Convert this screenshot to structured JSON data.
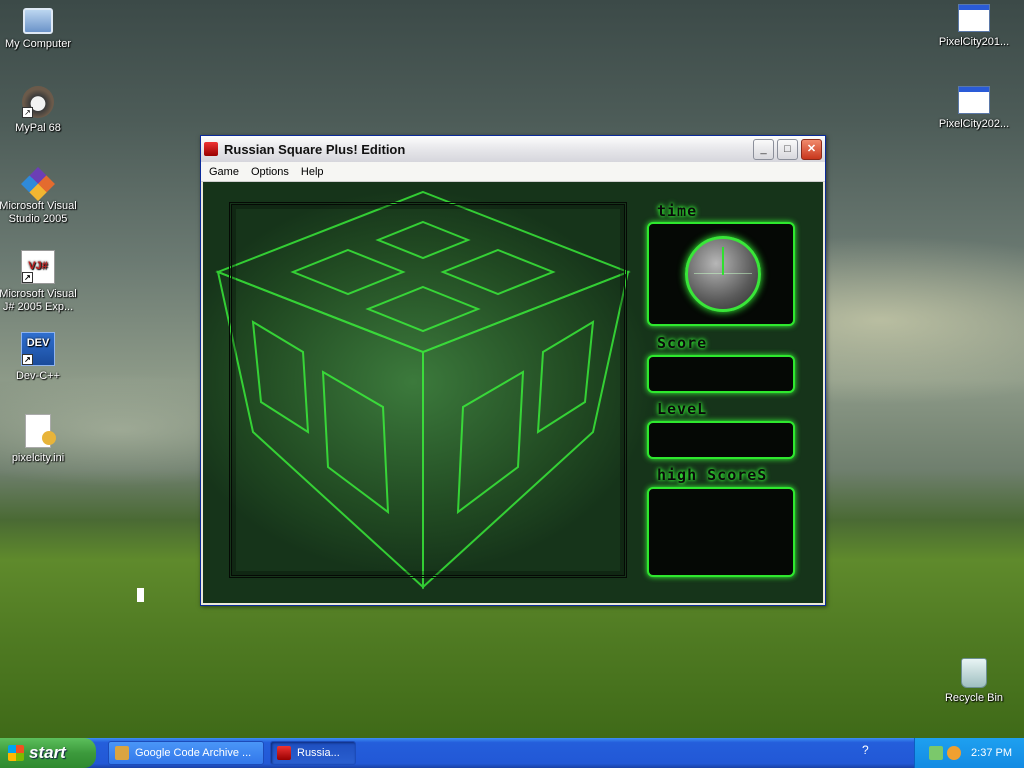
{
  "desktop": {
    "icons_left": [
      {
        "label": "My Computer",
        "icon": "computer-icon"
      },
      {
        "label": "MyPal 68",
        "icon": "raccoon-icon",
        "shortcut": true
      },
      {
        "label": "Microsoft Visual Studio 2005",
        "icon": "visual-studio-icon",
        "shortcut": true
      },
      {
        "label": "Microsoft Visual J# 2005 Exp...",
        "icon": "vjsharp-icon",
        "shortcut": true
      },
      {
        "label": "Dev-C++",
        "icon": "devcpp-icon",
        "shortcut": true
      },
      {
        "label": "pixelcity.ini",
        "icon": "ini-file-icon"
      }
    ],
    "icons_right": [
      {
        "label": "PixelCity201...",
        "icon": "window-app-icon"
      },
      {
        "label": "PixelCity202...",
        "icon": "window-app-icon"
      },
      {
        "label": "Recycle Bin",
        "icon": "recycle-bin-icon"
      }
    ]
  },
  "window": {
    "title": "Russian Square Plus! Edition",
    "menu": [
      "Game",
      "Options",
      "Help"
    ],
    "controls": {
      "minimize": "_",
      "maximize": "□",
      "close": "✕"
    },
    "panels": {
      "time_label": "time",
      "score_label": "Score",
      "level_label": "LeveL",
      "high_scores_label": "high ScoreS"
    }
  },
  "taskbar": {
    "start_label": "start",
    "tasks": [
      {
        "label": "Google Code Archive ...",
        "icon": "explorer-icon",
        "active": false
      },
      {
        "label": "Russia...",
        "icon": "russian-square-icon",
        "active": true
      }
    ],
    "help_glyph": "?",
    "clock": "2:37 PM"
  },
  "colors": {
    "accent_green": "#39ff39",
    "taskbar_blue": "#245edb",
    "start_green": "#3c9a3c"
  }
}
